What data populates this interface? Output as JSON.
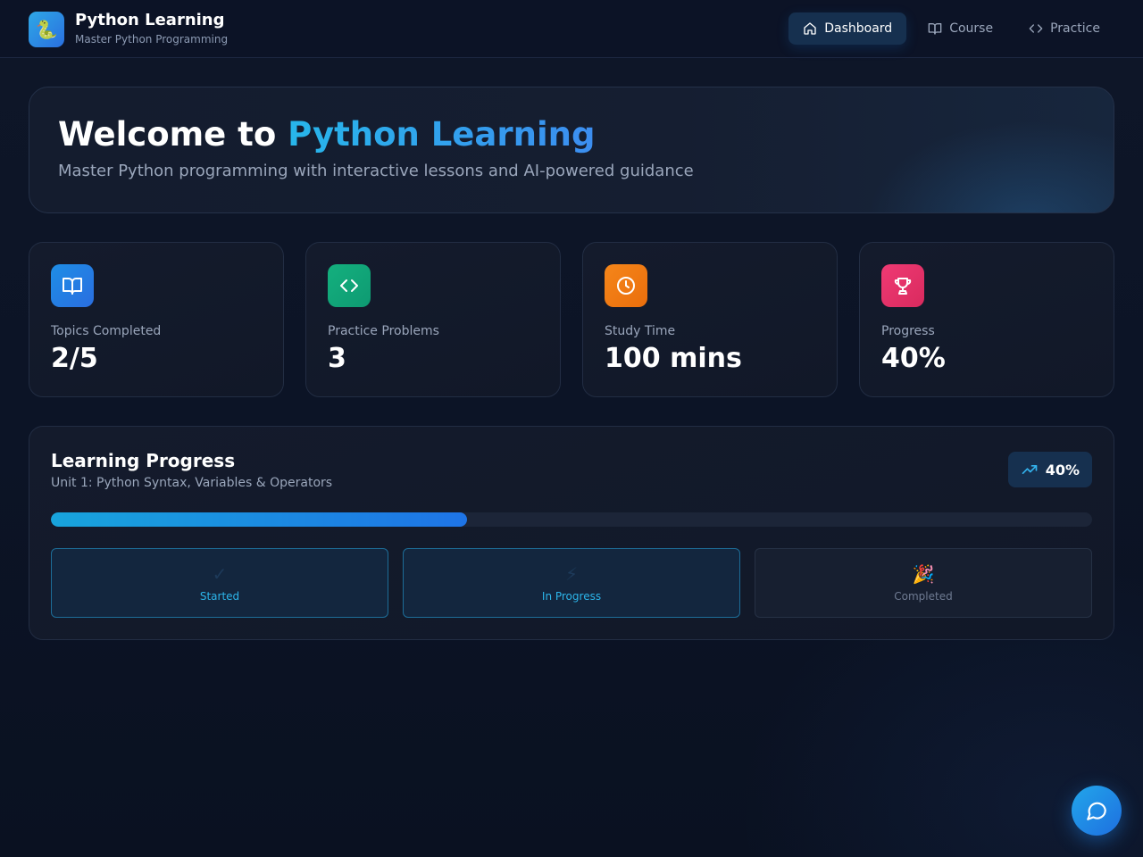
{
  "header": {
    "logo_glyph": "🐍",
    "title": "Python Learning",
    "subtitle": "Master Python Programming",
    "nav": [
      {
        "label": "Dashboard",
        "icon": "home-icon",
        "active": true
      },
      {
        "label": "Course",
        "icon": "book-open-icon",
        "active": false
      },
      {
        "label": "Practice",
        "icon": "code-icon",
        "active": false
      }
    ]
  },
  "hero": {
    "title_prefix": "Welcome to ",
    "title_accent": "Python Learning",
    "subtitle": "Master Python programming with interactive lessons and AI-powered guidance"
  },
  "stats": [
    {
      "label": "Topics Completed",
      "value": "2/5",
      "icon": "book-open-icon",
      "color": "#1f7fe0"
    },
    {
      "label": "Practice Problems",
      "value": "3",
      "icon": "code-icon",
      "color": "#12a37a"
    },
    {
      "label": "Study Time",
      "value": "100 mins",
      "icon": "clock-icon",
      "color": "#f07a12"
    },
    {
      "label": "Progress",
      "value": "40%",
      "icon": "trophy-icon",
      "color": "#e5306a"
    }
  ],
  "learning_progress": {
    "title": "Learning Progress",
    "subtitle": "Unit 1: Python Syntax, Variables & Operators",
    "badge": "40%",
    "fraction": 0.4,
    "stages": [
      {
        "glyph": "✓",
        "label": "Started",
        "state": "active"
      },
      {
        "glyph": "⚡",
        "label": "In Progress",
        "state": "active"
      },
      {
        "glyph": "🎉",
        "label": "Completed",
        "state": "inactive"
      }
    ]
  },
  "colors": {
    "accent": "#1fa6e6",
    "background": "#0c1324"
  }
}
